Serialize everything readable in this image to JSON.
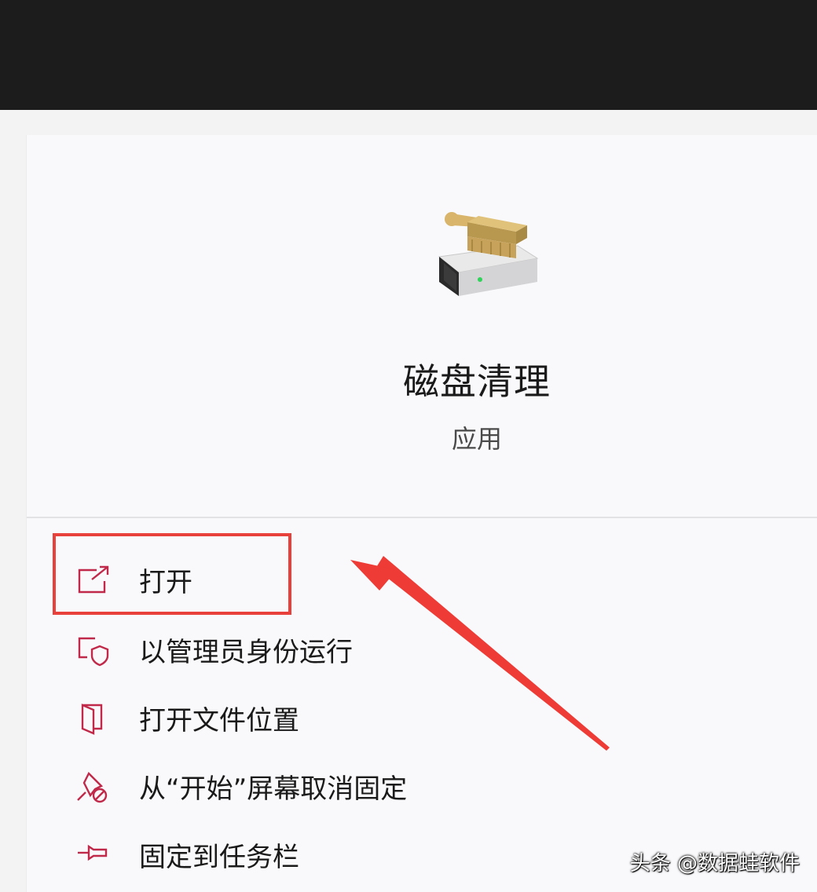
{
  "app": {
    "name": "磁盘清理",
    "type": "应用",
    "icon": "disk-cleanup-icon"
  },
  "menu": [
    {
      "label": "打开",
      "icon": "open-external-icon"
    },
    {
      "label": "以管理员身份运行",
      "icon": "run-as-admin-shield-icon"
    },
    {
      "label": "打开文件位置",
      "icon": "file-location-icon"
    },
    {
      "label": "从“开始”屏幕取消固定",
      "icon": "unpin-icon"
    },
    {
      "label": "固定到任务栏",
      "icon": "pin-icon"
    }
  ],
  "watermark": "头条 @数据蛙软件",
  "colors": {
    "topbar": "#1c1c1c",
    "background": "#f3f3f3",
    "card": "#f9f9fb",
    "icon_accent": "#c0294a",
    "highlight": "#e8403b"
  }
}
